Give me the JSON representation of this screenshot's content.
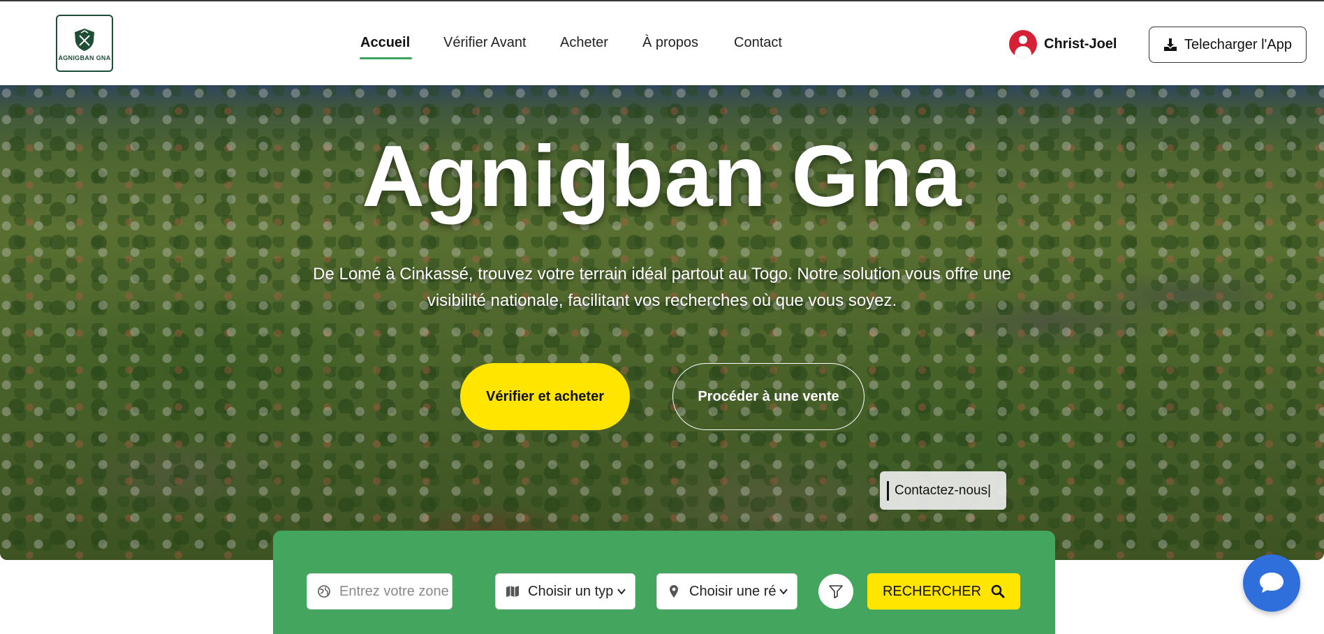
{
  "brand": {
    "logo_text": "AGNIGBAN GNA",
    "logo_color": "#1f4d36"
  },
  "nav": {
    "items": [
      {
        "label": "Accueil",
        "active": true
      },
      {
        "label": "Vérifier Avant",
        "active": false
      },
      {
        "label": "Acheter",
        "active": false
      },
      {
        "label": "À propos",
        "active": false
      },
      {
        "label": "Contact",
        "active": false
      }
    ],
    "accent_color": "#3aa35a"
  },
  "user": {
    "name": "Christ-Joel",
    "avatar_icon": "user-circle-icon",
    "avatar_color": "#d62035"
  },
  "download": {
    "label": "Telecharger l'App",
    "icon": "download-icon"
  },
  "hero": {
    "title": "Agnigban Gna",
    "subtitle": "De Lomé à Cinkassé, trouvez votre terrain idéal partout au Togo. Notre solution vous offre une visibilité nationale, facilitant vos recherches où que vous soyez.",
    "primary_button": "Vérifier et acheter",
    "secondary_button": "Procéder à une vente",
    "contact_chip": "Contactez-nous|",
    "primary_color": "#ffe500"
  },
  "search": {
    "zone_placeholder": "Entrez votre zone pre",
    "type_select": "Choisir un typ",
    "region_select": "Choisir une ré",
    "search_button": "RECHERCHER",
    "panel_color": "#44a65e",
    "icons": {
      "zone": "globe-icon",
      "type": "map-icon",
      "region": "map-pin-icon",
      "filter": "filter-icon",
      "search": "search-icon"
    }
  },
  "chat": {
    "icon": "chat-bubble-icon",
    "color": "#2f6fdb"
  }
}
